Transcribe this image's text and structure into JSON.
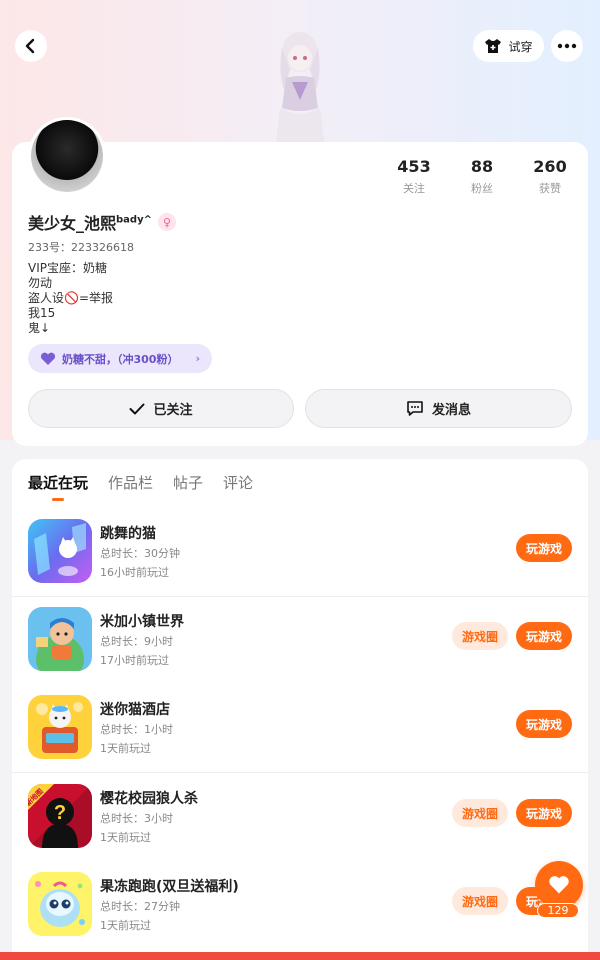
{
  "header": {
    "tryon_label": "试穿"
  },
  "stats": [
    {
      "value": "453",
      "label": "关注"
    },
    {
      "value": "88",
      "label": "粉丝"
    },
    {
      "value": "260",
      "label": "获赞"
    }
  ],
  "profile": {
    "name": "美少女_池熙",
    "name_sup": "bady^",
    "gender_symbol": "♀",
    "uid": "233号：223326618",
    "bio": [
      "VIP宝座：奶糖",
      "勿动",
      "盗人设🚫=举报",
      "我15",
      "鬼↓"
    ],
    "fan_badge": "奶糖不甜，（冲300粉）",
    "followed_label": "已关注",
    "message_label": "发消息"
  },
  "tabs": [
    "最近在玩",
    "作品栏",
    "帖子",
    "评论"
  ],
  "games": [
    {
      "title": "跳舞的猫",
      "duration": "总时长：30分钟",
      "last_played": "16小时前玩过",
      "has_circle": false
    },
    {
      "title": "米加小镇世界",
      "duration": "总时长：9小时",
      "last_played": "17小时前玩过",
      "has_circle": true
    },
    {
      "title": "迷你猫酒店",
      "duration": "总时长：1小时",
      "last_played": "1天前玩过",
      "has_circle": false
    },
    {
      "title": "樱花校园狼人杀",
      "duration": "总时长：3小时",
      "last_played": "1天前玩过",
      "has_circle": true,
      "icon_badge": "新地图"
    },
    {
      "title": "果冻跑跑(双旦送福利)",
      "duration": "总时长：27分钟",
      "last_played": "1天前玩过",
      "has_circle": true
    }
  ],
  "buttons": {
    "play": "玩游戏",
    "circle": "游戏圈"
  },
  "like": {
    "count": "129"
  },
  "colors": {
    "accent": "#ff6a13",
    "badge_bg": "#ebe6fb",
    "badge_text": "#6a4fc9"
  }
}
